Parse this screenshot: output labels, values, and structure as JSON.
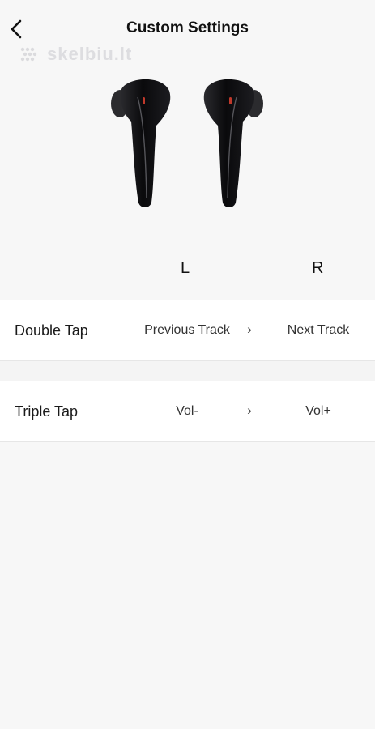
{
  "header": {
    "title": "Custom Settings",
    "back_icon": "chevron-left-icon",
    "watermark": "skelbiu.lt"
  },
  "earbuds": {
    "image": "black-earbuds-pair",
    "left_label": "L",
    "right_label": "R",
    "colors": {
      "body": "#0d0d0f",
      "indicator": "#c0392b"
    }
  },
  "settings": {
    "double_tap": {
      "label": "Double Tap",
      "left": "Previous Track",
      "arrow": "›",
      "right": "Next Track"
    },
    "triple_tap": {
      "label": "Triple Tap",
      "left": "Vol-",
      "arrow": "›",
      "right": "Vol+"
    }
  }
}
